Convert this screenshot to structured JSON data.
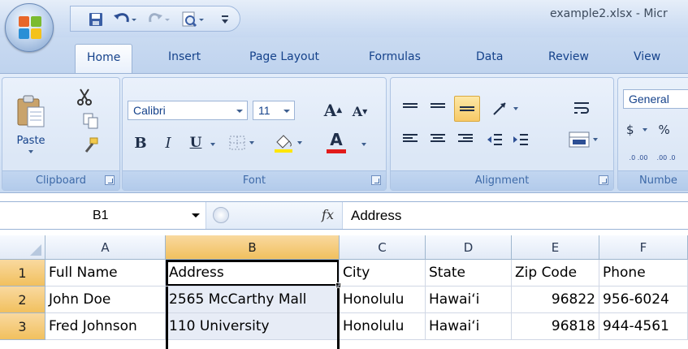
{
  "window": {
    "title": "example2.xlsx - Micr"
  },
  "office_button": {
    "icon": "office-logo-icon"
  },
  "quick_access": {
    "icons": [
      "save-icon",
      "undo-icon",
      "redo-icon",
      "print-preview-icon",
      "customize-qat-icon"
    ]
  },
  "tabs": [
    {
      "label": "Home",
      "active": true
    },
    {
      "label": "Insert"
    },
    {
      "label": "Page Layout"
    },
    {
      "label": "Formulas"
    },
    {
      "label": "Data"
    },
    {
      "label": "Review"
    },
    {
      "label": "View"
    }
  ],
  "ribbon": {
    "clipboard": {
      "label": "Clipboard",
      "paste_label": "Paste"
    },
    "font": {
      "label": "Font",
      "font_name": "Calibri",
      "font_size": "11",
      "bold": "B",
      "italic": "I",
      "underline": "U",
      "grow": "A",
      "shrink": "A",
      "font_color_glyph": "A"
    },
    "alignment": {
      "label": "Alignment"
    },
    "number": {
      "label": "Numbe",
      "format": "General",
      "currency": "$",
      "percent": "%",
      "inc_decimal": ".0 .00",
      "dec_decimal": ".00 .0"
    }
  },
  "formula_bar": {
    "name_box": "B1",
    "fx": "fx",
    "content": "Address"
  },
  "grid": {
    "columns": [
      "A",
      "B",
      "C",
      "D",
      "E",
      "F"
    ],
    "selected_column": "B",
    "rows": [
      {
        "n": "1",
        "cells": [
          "Full Name",
          "Address",
          "City",
          "State",
          "Zip Code",
          "Phone"
        ]
      },
      {
        "n": "2",
        "cells": [
          "John Doe",
          "2565 McCarthy Mall",
          "Honolulu",
          "Hawai‘i",
          "96822",
          "956-6024"
        ]
      },
      {
        "n": "3",
        "cells": [
          "Fred Johnson",
          "110 University",
          "Honolulu",
          "Hawai‘i",
          "96818",
          "944-4561"
        ]
      }
    ]
  },
  "colors": {
    "ribbon_text": "#15428b",
    "selection_header": "#f1c05e",
    "font_color_bar": "#e21b1b",
    "highlight_bar": "#ffe600"
  }
}
